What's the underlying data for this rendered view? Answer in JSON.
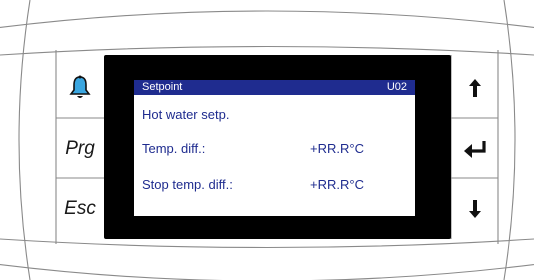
{
  "colors": {
    "lcd_accent": "#1f2c8f",
    "bezel": "#000000",
    "frame_line": "#8a8a8a"
  },
  "keys": {
    "alarm_icon": "alarm-bell-icon",
    "prg_label": "Prg",
    "esc_label": "Esc",
    "up_icon": "arrow-up-icon",
    "enter_icon": "enter-return-icon",
    "down_icon": "arrow-down-icon"
  },
  "screen": {
    "header_title": "Setpoint",
    "header_code": "U02",
    "line1": "Hot water setp.",
    "rows": [
      {
        "label": "Temp. diff.:",
        "value": "+RR.R°C"
      },
      {
        "label": "Stop temp. diff.:",
        "value": "+RR.R°C"
      }
    ]
  }
}
